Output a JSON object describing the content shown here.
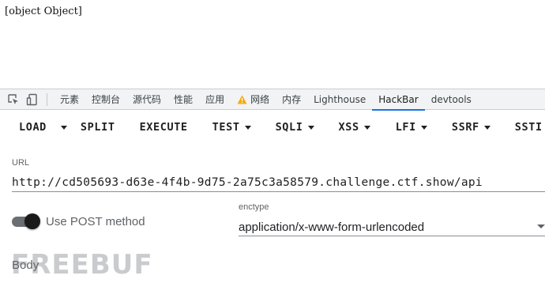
{
  "page": {
    "text": "[object Object]"
  },
  "devtools": {
    "tools": [
      {
        "icon": "inspect-element-icon"
      },
      {
        "icon": "device-toolbar-icon"
      }
    ],
    "tabs": [
      {
        "label": "元素"
      },
      {
        "label": "控制台"
      },
      {
        "label": "源代码"
      },
      {
        "label": "性能"
      },
      {
        "label": "应用"
      },
      {
        "label": "网络",
        "icon": "warning-icon"
      },
      {
        "label": "内存"
      },
      {
        "label": "Lighthouse"
      },
      {
        "label": "HackBar",
        "active": true
      },
      {
        "label": "devtools"
      }
    ]
  },
  "hackbar": {
    "buttons": {
      "load": "LOAD",
      "split": "SPLIT",
      "execute": "EXECUTE",
      "test": "TEST",
      "sqli": "SQLI",
      "xss": "XSS",
      "lfi": "LFI",
      "ssrf": "SSRF",
      "ssti": "SSTI"
    },
    "url": {
      "label": "URL",
      "value": "http://cd505693-d63e-4f4b-9d75-2a75c3a58579.challenge.ctf.show/api"
    },
    "post": {
      "label": "Use POST method",
      "enabled": true
    },
    "enctype": {
      "label": "enctype",
      "value": "application/x-www-form-urlencoded"
    },
    "body": {
      "label": "Body"
    }
  },
  "colors": {
    "active_tab_indicator": "#1a73e8",
    "warning": "#f9ab00",
    "toggle_track": "#6b6f73",
    "toggle_thumb": "#1a1a1a"
  },
  "watermark": {
    "text": "FREEBUF"
  }
}
